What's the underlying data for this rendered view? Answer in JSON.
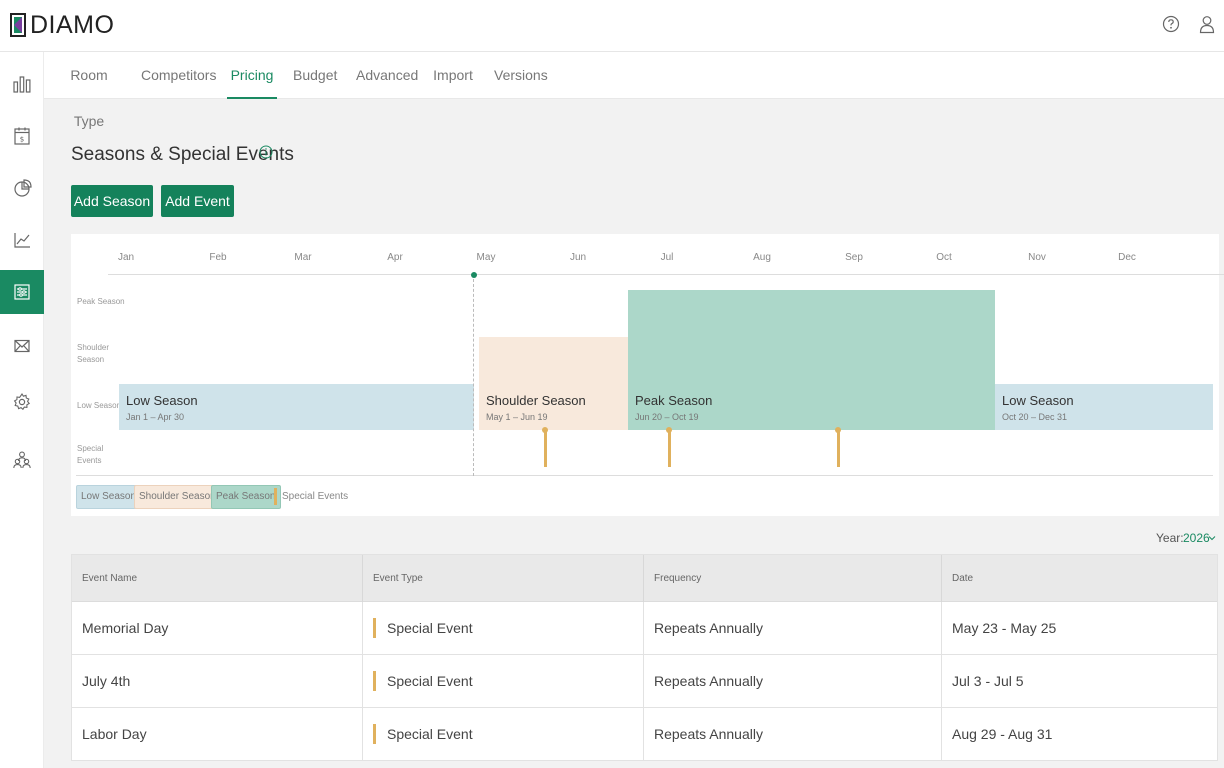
{
  "app": {
    "logo_text": "DIAMO"
  },
  "colors": {
    "accent": "#1a8a62",
    "low": "#cfe3ea",
    "shoulder": "#f8e9dc",
    "peak": "#acd7c9",
    "event": "#e0b15d"
  },
  "tabs": [
    {
      "label": "Room Type"
    },
    {
      "label": "Competitors"
    },
    {
      "label": "Pricing",
      "active": true
    },
    {
      "label": "Budget"
    },
    {
      "label": "Advanced"
    },
    {
      "label": "Import"
    },
    {
      "label": "Versions"
    }
  ],
  "page": {
    "title": "Seasons & Special Events",
    "add_season": "Add Season",
    "add_event": "Add Event"
  },
  "timeline": {
    "months": [
      "Jan",
      "Feb",
      "Mar",
      "Apr",
      "May",
      "Jun",
      "Jul",
      "Aug",
      "Sep",
      "Oct",
      "Nov",
      "Dec"
    ],
    "row_labels": {
      "peak": "Peak Season",
      "shoulder_1": "Shoulder",
      "shoulder_2": "Season",
      "low": "Low Season",
      "special_1": "Special",
      "special_2": "Events"
    },
    "seasons": [
      {
        "name": "Low Season",
        "dates": "Jan 1 – Apr 30",
        "level": "low"
      },
      {
        "name": "Shoulder Season",
        "dates": "May 1 – Jun 19",
        "level": "shoulder"
      },
      {
        "name": "Peak Season",
        "dates": "Jun 20 – Oct 19",
        "level": "peak"
      },
      {
        "name": "Low Season",
        "dates": "Oct 20 – Dec 31",
        "level": "low"
      }
    ],
    "legend": {
      "low": "Low Season",
      "shoulder": "Shoulder Season",
      "peak": "Peak Season",
      "events": "Special Events"
    }
  },
  "year": {
    "label": "Year:",
    "value": "2026"
  },
  "table": {
    "headers": [
      "Event Name",
      "Event Type",
      "Frequency",
      "Date"
    ],
    "rows": [
      {
        "name": "Memorial Day",
        "type": "Special Event",
        "frequency": "Repeats Annually",
        "date": "May 23 - May 25"
      },
      {
        "name": "July 4th",
        "type": "Special Event",
        "frequency": "Repeats Annually",
        "date": "Jul 3 - Jul 5"
      },
      {
        "name": "Labor Day",
        "type": "Special Event",
        "frequency": "Repeats Annually",
        "date": "Aug 29 - Aug 31"
      }
    ]
  }
}
